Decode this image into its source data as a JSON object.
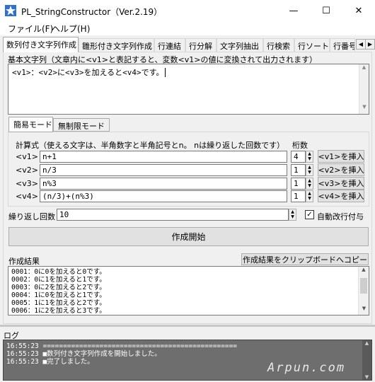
{
  "window": {
    "title": "PL_StringConstructor（Ver.2.19）",
    "controls": [
      "—",
      "☐",
      "✕"
    ]
  },
  "menu": {
    "items": [
      "ファイル(F)",
      "ヘルプ(H)"
    ]
  },
  "tabs": [
    "数列付き文字列作成",
    "雛形付き文字列作成",
    "行連結",
    "行分解",
    "文字列抽出",
    "行検索",
    "行ソート",
    "行番号"
  ],
  "base": {
    "label": "基本文字列（文章内に<v1>と表記すると、変数<v1>の値に変換されて出力されます）",
    "text": "<v1>：<v2>に<v3>を加えると<v4>です。"
  },
  "mode_tabs": [
    "簡易モード",
    "無制限モード"
  ],
  "formula": {
    "header": "計算式（使える文字は、半角数字と半角記号とn。 nは繰り返した回数です）",
    "digits_header": "桁数",
    "rows": [
      {
        "var": "<v1> =",
        "expr": "n+1",
        "digits": "4",
        "insert": "<v1>を挿入"
      },
      {
        "var": "<v2> =",
        "expr": "n/3",
        "digits": "1",
        "insert": "<v2>を挿入"
      },
      {
        "var": "<v3> =",
        "expr": "n%3",
        "digits": "1",
        "insert": "<v3>を挿入"
      },
      {
        "var": "<v4> =",
        "expr": "(n/3)+(n%3)",
        "digits": "1",
        "insert": "<v4>を挿入"
      }
    ]
  },
  "repeat": {
    "label": "繰り返し回数",
    "value": "10",
    "auto_newline": "自動改行付与",
    "auto_newline_checked": true
  },
  "create_button": "作成開始",
  "result": {
    "label": "作成結果",
    "copy_button": "作成結果をクリップボードへコピー",
    "lines": [
      "0001：0に0を加えると0です。",
      "0002：0に1を加えると1です。",
      "0003：0に2を加えると2です。",
      "0004：1に0を加えると1です。",
      "0005：1に1を加えると2です。",
      "0006：1に2を加えると3です。"
    ]
  },
  "log": {
    "label": "ログ",
    "lines": [
      "16:55:23 ================================================",
      "16:55:23 ■数列付き文字列作成を開始しました。",
      "16:55:23 ■完了しました。"
    ]
  },
  "watermark": "Arpun.com"
}
